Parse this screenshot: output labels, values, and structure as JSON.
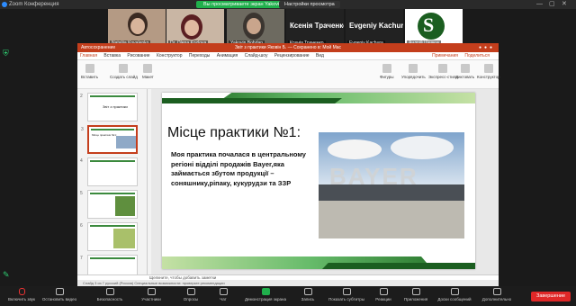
{
  "zoom": {
    "window_title": "Zoom Конференция",
    "banner": "Вы просматриваете экран Yakovin Bohdan",
    "view_settings": "Настройки просмотра",
    "participants": [
      {
        "name": "Nataliia Kovalenko"
      },
      {
        "name": "Dr. Olena Kozlova"
      },
      {
        "name": "Yakovin Bohdan"
      },
      {
        "name": "Ксенія Траченко",
        "big": "Ксенія Траченко"
      },
      {
        "name": "Evgeniy Kachura",
        "big": "Evgeniy Kachura"
      },
      {
        "name": "Андрій Шевчук"
      }
    ],
    "toolbar": [
      {
        "label": "Включить звук",
        "icon": "mic-muted-icon"
      },
      {
        "label": "Остановить видео",
        "icon": "video-icon"
      },
      {
        "label": "Безопасность",
        "icon": "shield-icon"
      },
      {
        "label": "Участники",
        "icon": "participants-icon"
      },
      {
        "label": "Опросы",
        "icon": "polls-icon"
      },
      {
        "label": "Чат",
        "icon": "chat-icon"
      },
      {
        "label": "Демонстрация экрана",
        "icon": "share-screen-icon"
      },
      {
        "label": "Запись",
        "icon": "record-icon"
      },
      {
        "label": "Показать субтитры",
        "icon": "cc-icon"
      },
      {
        "label": "Реакции",
        "icon": "reactions-icon"
      },
      {
        "label": "Приложения",
        "icon": "apps-icon"
      },
      {
        "label": "Доски сообщений",
        "icon": "whiteboard-icon"
      },
      {
        "label": "Дополнительно",
        "icon": "more-icon"
      }
    ],
    "end_label": "Завершение"
  },
  "ppt": {
    "quick_access": "Автосохранение",
    "title": "Звіт з практики Яковін Б. — Сохранено в: Мой Mac",
    "menu": [
      "Главная",
      "Вставка",
      "Рисование",
      "Конструктор",
      "Переходы",
      "Анимация",
      "Слайд-шоу",
      "Рецензирование",
      "Вид"
    ],
    "menu_right": [
      "Примечания",
      "Поделиться"
    ],
    "ribbon": [
      {
        "label": "Вставить"
      },
      {
        "label": "Создать слайд"
      },
      {
        "label": "Макет"
      },
      {
        "label": "Фигуры"
      },
      {
        "label": "Упорядочить"
      },
      {
        "label": "Экспресс-стили"
      },
      {
        "label": "Диктовать"
      },
      {
        "label": "Конструктор"
      }
    ],
    "slide": {
      "title": "Місце практики №1:",
      "body": "Моя практика почалася в центральному регіоні відділі продажів Bayer,яка займається збутом продукції –соняшнику,ріпаку, кукурудзи та ЗЗР",
      "photo_label": "BAYER"
    },
    "notes_placeholder": "Щелкните, чтобы добавить заметки",
    "status": "Слайд 3 из 7    русский (Россия)    Специальные возможности: проверьте рекомендации",
    "thumbs": [
      {
        "n": "2",
        "title": "Звіт з практики"
      },
      {
        "n": "3",
        "title": "Місце практики №1:",
        "selected": true
      },
      {
        "n": "4",
        "title": ""
      },
      {
        "n": "5",
        "title": ""
      },
      {
        "n": "6",
        "title": ""
      },
      {
        "n": "7",
        "title": ""
      }
    ]
  }
}
